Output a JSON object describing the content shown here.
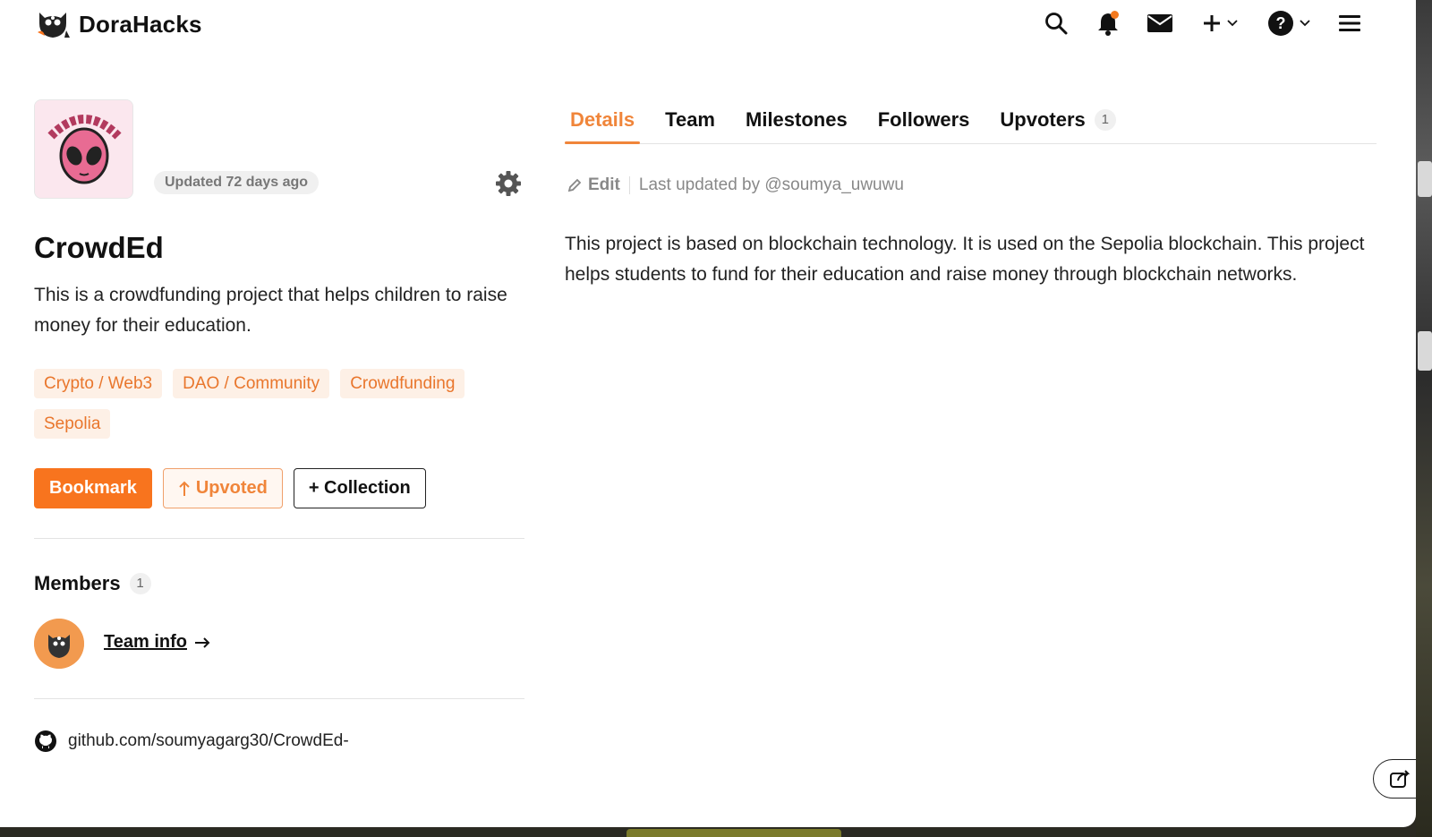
{
  "header": {
    "brand": "DoraHacks",
    "icons": [
      "search-icon",
      "bell-icon",
      "mail-icon",
      "plus-icon",
      "help-icon",
      "menu-icon"
    ],
    "accent": "#f8741e"
  },
  "project": {
    "updated": "Updated 72 days ago",
    "title": "CrowdEd",
    "description": "This is a crowdfunding project that helps children to raise money for their education.",
    "tags": [
      "Crypto / Web3",
      "DAO / Community",
      "Crowdfunding",
      "Sepolia"
    ],
    "buttons": {
      "bookmark": "Bookmark",
      "upvoted": "Upvoted",
      "collection": "+ Collection"
    },
    "members": {
      "label": "Members",
      "count": "1",
      "team_info": "Team info"
    },
    "github": "github.com/soumyagarg30/CrowdEd-"
  },
  "tabs": [
    {
      "label": "Details",
      "active": true
    },
    {
      "label": "Team"
    },
    {
      "label": "Milestones"
    },
    {
      "label": "Followers"
    },
    {
      "label": "Upvoters",
      "count": "1"
    }
  ],
  "details": {
    "edit": "Edit",
    "last_updated": "Last updated by @soumya_uwuwu",
    "body": "This project is based on blockchain technology. It is used on the Sepolia blockchain. This project helps students to fund for their education and raise money through blockchain networks."
  }
}
